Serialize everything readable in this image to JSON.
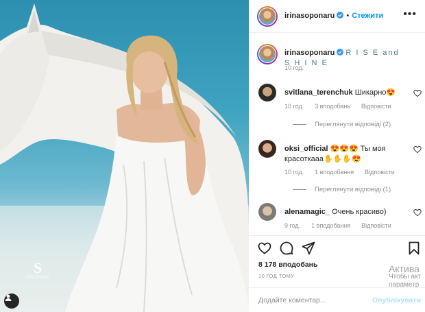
{
  "post": {
    "author": "irinasoponaru",
    "follow_label": "Стежити",
    "caption": "R I S E and S H I N E",
    "caption_time": "10 год.",
    "likes": "8 178 вподобань",
    "time_ago": "10 ГОД ТОМУ"
  },
  "comments": [
    {
      "user": "svitlana_terenchuk",
      "text": "Шикарно😍",
      "time": "10 год.",
      "likes": "3 вподобань",
      "reply_label": "Відповісти",
      "view_replies": "Переглянути відповіді (2)"
    },
    {
      "user": "oksi_official",
      "text": "😍😍😍 Ты моя красоткааа✋✋✋😍",
      "time": "10 год.",
      "likes": "1 вподобання",
      "reply_label": "Відповісти",
      "view_replies": "Переглянути відповіді (1)"
    },
    {
      "user": "alenamagic_",
      "text": "Очень красиво)",
      "time": "9 год.",
      "likes": "1 вподобання",
      "reply_label": "Відповісти"
    }
  ],
  "comment_box": {
    "placeholder": "Додайте коментар...",
    "publish_label": "Опублікувати"
  },
  "windows_activation": {
    "line1": "Актива",
    "line2": "Чтобы акт",
    "line3": "параметр"
  },
  "watermark": {
    "mark": "S",
    "sub": "ChicShoots"
  },
  "colors": {
    "link": "#0095f6",
    "publish_disabled": "#b2dffc",
    "muted": "#8e8e8e",
    "sky": "#3ea3c0"
  },
  "icons": [
    "heart-icon",
    "comment-icon",
    "share-icon",
    "bookmark-icon",
    "verified-icon",
    "more-icon",
    "user-tag-icon"
  ]
}
